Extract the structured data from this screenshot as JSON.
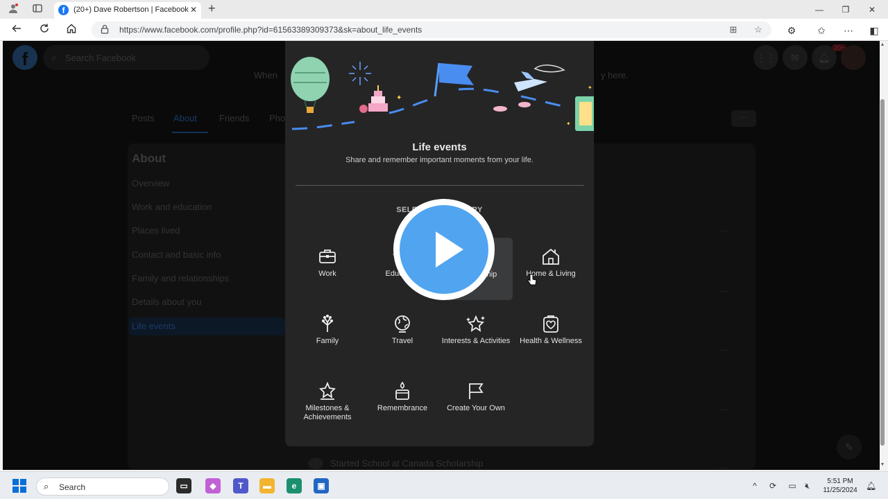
{
  "browser": {
    "tab_title": "(20+) Dave Robertson | Facebook",
    "tab_favicon": "f",
    "url": "https://www.facebook.com/profile.php?id=61563389309373&sk=about_life_events"
  },
  "fb": {
    "logo": "f",
    "search_placeholder": "Search Facebook",
    "notification_badge": "20+",
    "banner_left": "When",
    "banner_right": "y here.",
    "tabs": [
      "Posts",
      "About",
      "Friends",
      "Pho"
    ],
    "more": "···",
    "about": {
      "title": "About",
      "items": [
        "Overview",
        "Work and education",
        "Places lived",
        "Contact and basic info",
        "Family and relationships",
        "Details about you",
        "Life events"
      ]
    },
    "row_dots": "···",
    "started_text": "Started School at Canada Scholarship"
  },
  "modal": {
    "title": "Life events",
    "subtitle": "Share and remember important moments from your life.",
    "select_category": "SELECT A CATEGORY",
    "categories": [
      {
        "label": "Work",
        "icon": "briefcase-icon"
      },
      {
        "label": "Education",
        "icon": "graduation-icon"
      },
      {
        "label": "Relationship",
        "icon": "heart-icon"
      },
      {
        "label": "Home & Living",
        "icon": "house-icon"
      },
      {
        "label": "Family",
        "icon": "family-tree-icon"
      },
      {
        "label": "Travel",
        "icon": "globe-icon"
      },
      {
        "label": "Interests & Activities",
        "icon": "stars-icon"
      },
      {
        "label": "Health & Wellness",
        "icon": "heart-clipboard-icon"
      },
      {
        "label": "Milestones & Achievements",
        "icon": "star-trophy-icon"
      },
      {
        "label": "Remembrance",
        "icon": "candle-icon"
      },
      {
        "label": "Create Your Own",
        "icon": "flag-icon"
      }
    ],
    "visible_labels": {
      "education": "Educ",
      "relationship": "hip"
    }
  },
  "taskbar": {
    "search_placeholder": "Search",
    "time": "5:51 PM",
    "date": "11/25/2024"
  },
  "colors": {
    "fb_blue": "#1877f2",
    "modal_bg": "#252526",
    "play_blue": "#50a4f0"
  }
}
